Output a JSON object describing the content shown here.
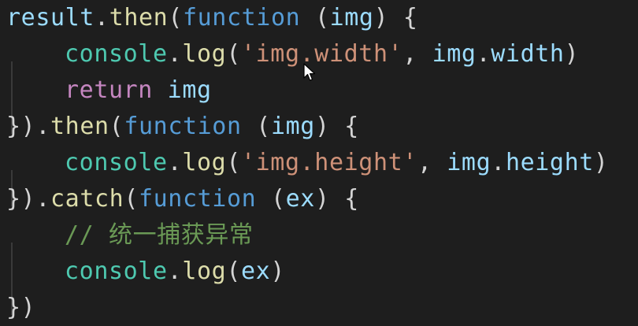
{
  "code": {
    "lines": [
      [
        {
          "t": "result",
          "k": "id"
        },
        {
          "t": ".",
          "k": "punct"
        },
        {
          "t": "then",
          "k": "fn"
        },
        {
          "t": "(",
          "k": "punct"
        },
        {
          "t": "function",
          "k": "kw"
        },
        {
          "t": " (",
          "k": "punct"
        },
        {
          "t": "img",
          "k": "id"
        },
        {
          "t": ") {",
          "k": "punct"
        }
      ],
      [
        {
          "t": "console",
          "k": "type"
        },
        {
          "t": ".",
          "k": "punct"
        },
        {
          "t": "log",
          "k": "fn"
        },
        {
          "t": "(",
          "k": "punct"
        },
        {
          "t": "'img.width'",
          "k": "str"
        },
        {
          "t": ", ",
          "k": "punct"
        },
        {
          "t": "img",
          "k": "id"
        },
        {
          "t": ".",
          "k": "punct"
        },
        {
          "t": "width",
          "k": "id"
        },
        {
          "t": ")",
          "k": "punct"
        }
      ],
      [
        {
          "t": "return",
          "k": "ctrl"
        },
        {
          "t": " ",
          "k": "punct"
        },
        {
          "t": "img",
          "k": "id"
        }
      ],
      [
        {
          "t": "}).",
          "k": "punct"
        },
        {
          "t": "then",
          "k": "fn"
        },
        {
          "t": "(",
          "k": "punct"
        },
        {
          "t": "function",
          "k": "kw"
        },
        {
          "t": " (",
          "k": "punct"
        },
        {
          "t": "img",
          "k": "id"
        },
        {
          "t": ") {",
          "k": "punct"
        }
      ],
      [
        {
          "t": "console",
          "k": "type"
        },
        {
          "t": ".",
          "k": "punct"
        },
        {
          "t": "log",
          "k": "fn"
        },
        {
          "t": "(",
          "k": "punct"
        },
        {
          "t": "'img.height'",
          "k": "str"
        },
        {
          "t": ", ",
          "k": "punct"
        },
        {
          "t": "img",
          "k": "id"
        },
        {
          "t": ".",
          "k": "punct"
        },
        {
          "t": "height",
          "k": "id"
        },
        {
          "t": ")",
          "k": "punct"
        }
      ],
      [
        {
          "t": "}).",
          "k": "punct"
        },
        {
          "t": "catch",
          "k": "fn"
        },
        {
          "t": "(",
          "k": "punct"
        },
        {
          "t": "function",
          "k": "kw"
        },
        {
          "t": " (",
          "k": "punct"
        },
        {
          "t": "ex",
          "k": "id"
        },
        {
          "t": ") {",
          "k": "punct"
        }
      ],
      [
        {
          "t": "// 统一捕获异常",
          "k": "comment"
        }
      ],
      [
        {
          "t": "console",
          "k": "type"
        },
        {
          "t": ".",
          "k": "punct"
        },
        {
          "t": "log",
          "k": "fn"
        },
        {
          "t": "(",
          "k": "punct"
        },
        {
          "t": "ex",
          "k": "id"
        },
        {
          "t": ")",
          "k": "punct"
        }
      ],
      [
        {
          "t": "})",
          "k": "punct"
        }
      ]
    ],
    "indents": [
      0,
      1,
      1,
      0,
      1,
      0,
      1,
      1,
      0
    ]
  },
  "colors": {
    "background": "#1e1e1e",
    "identifier": "#9cdcfe",
    "function": "#dcdcaa",
    "type": "#4ec9b0",
    "keyword": "#569cd6",
    "control": "#c586c0",
    "string": "#ce9178",
    "comment": "#6a9955",
    "punctuation": "#d4d4d4"
  },
  "icons": {
    "cursor": "mouse-pointer-icon"
  }
}
